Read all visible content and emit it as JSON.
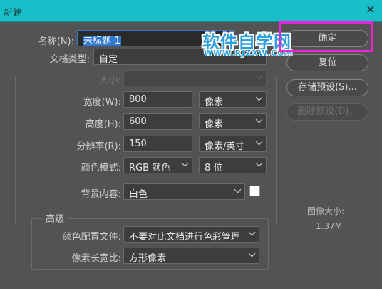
{
  "window": {
    "title": "新建",
    "close_glyph": "✕"
  },
  "form": {
    "name_label": "名称(N):",
    "name_value": "未标题-1",
    "doc_type_label": "文档类型:",
    "doc_type_value": "自定",
    "size_label": "大小:",
    "size_value": "",
    "width_label": "宽度(W):",
    "width_value": "800",
    "width_unit": "像素",
    "height_label": "高度(H):",
    "height_value": "600",
    "height_unit": "像素",
    "resolution_label": "分辨率(R):",
    "resolution_value": "150",
    "resolution_unit": "像素/英寸",
    "color_mode_label": "颜色模式:",
    "color_mode_value": "RGB 颜色",
    "bit_depth_value": "8 位",
    "background_label": "背景内容:",
    "background_value": "白色",
    "background_swatch_color": "#ffffff"
  },
  "advanced": {
    "legend": "高级",
    "color_profile_label": "颜色配置文件:",
    "color_profile_value": "不要对此文档进行色彩管理",
    "pixel_aspect_label": "像素长宽比:",
    "pixel_aspect_value": "方形像素"
  },
  "buttons": {
    "ok": "确定",
    "reset": "复位",
    "save_preset": "存储预设(S)...",
    "delete_preset": "删除预设(D)..."
  },
  "image_info": {
    "title": "图像大小:",
    "value": "1.37M"
  },
  "watermark": {
    "main": "软件自学网",
    "sub": "WWW.RJZXW.COM"
  },
  "colors": {
    "titlebar": "#18bfc8",
    "highlight": "#ee22d9",
    "selection": "#2f78d0"
  }
}
